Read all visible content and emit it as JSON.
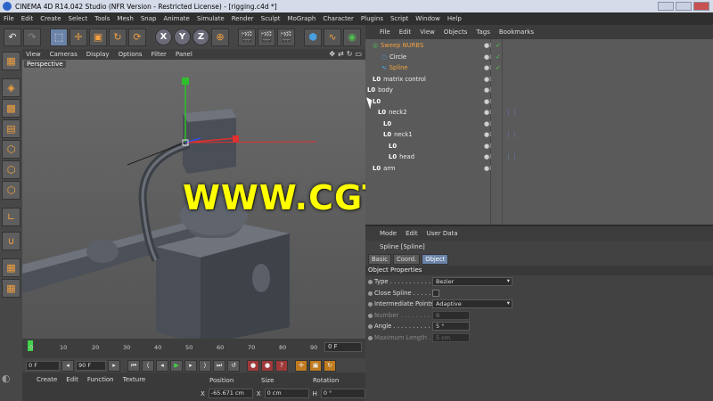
{
  "window": {
    "title": "CINEMA 4D R14.042 Studio (NFR Version - Restricted License) - [rigging.c4d *]"
  },
  "menubar": [
    "File",
    "Edit",
    "Create",
    "Select",
    "Tools",
    "Mesh",
    "Snap",
    "Animate",
    "Simulate",
    "Render",
    "Sculpt",
    "MoGraph",
    "Character",
    "Plugins",
    "Script",
    "Window",
    "Help"
  ],
  "toolbar": {
    "undo_icon": "undo-icon",
    "redo_icon": "redo-icon",
    "axis_x": "X",
    "axis_y": "Y",
    "axis_z": "Z"
  },
  "viewport": {
    "menu": [
      "View",
      "Cameras",
      "Display",
      "Options",
      "Filter",
      "Panel"
    ],
    "label": "Perspective"
  },
  "watermark": "WWW.CGTSJ.COM",
  "timeline": {
    "ticks": [
      "0",
      "10",
      "20",
      "30",
      "40",
      "50",
      "60",
      "70",
      "80",
      "90"
    ],
    "current_frame": "0 F"
  },
  "transport": {
    "start_field": "0 F",
    "end_field": "90 F"
  },
  "material_menu": [
    "Create",
    "Edit",
    "Function",
    "Texture"
  ],
  "coordinates": {
    "headers": [
      "Position",
      "Size",
      "Rotation"
    ],
    "x_label": "X",
    "position_x": "-65.671 cm",
    "size_label": "X",
    "size_x": "0 cm",
    "rot_label": "H",
    "rotation_h": "0 °"
  },
  "object_manager": {
    "menu": [
      "File",
      "Edit",
      "View",
      "Objects",
      "Tags",
      "Bookmarks"
    ],
    "rows": [
      {
        "name": "Sweep NURBS",
        "icon": "sweep-icon",
        "indent": 8,
        "color": "#f0a040"
      },
      {
        "name": "Circle",
        "icon": "circle-icon",
        "indent": 18,
        "color": "#eeeeee"
      },
      {
        "name": "Spline",
        "icon": "spline-icon",
        "indent": 18,
        "color": "#f0a040"
      },
      {
        "name": "matrix control",
        "icon": "null-icon",
        "indent": 8,
        "color": "#eeeeee"
      },
      {
        "name": "body",
        "icon": "null-icon",
        "indent": 2,
        "color": "#eeeeee"
      },
      {
        "name": "",
        "icon": "null-icon",
        "indent": 8,
        "color": "#eeeeee"
      },
      {
        "name": "neck2",
        "icon": "null-icon",
        "indent": 14,
        "color": "#eeeeee"
      },
      {
        "name": "",
        "icon": "null-icon",
        "indent": 20,
        "color": "#eeeeee"
      },
      {
        "name": "neck1",
        "icon": "null-icon",
        "indent": 20,
        "color": "#eeeeee"
      },
      {
        "name": "",
        "icon": "null-icon",
        "indent": 26,
        "color": "#eeeeee"
      },
      {
        "name": "head",
        "icon": "null-icon",
        "indent": 26,
        "color": "#eeeeee"
      },
      {
        "name": "arm",
        "icon": "null-icon",
        "indent": 8,
        "color": "#eeeeee"
      }
    ]
  },
  "attribute_manager": {
    "menu": [
      "Mode",
      "Edit",
      "User Data"
    ],
    "object_title": "Spline [Spline]",
    "tabs": [
      "Basic",
      "Coord.",
      "Object"
    ],
    "section": "Object Properties",
    "props": [
      {
        "label": "Type . . . . . . . . . . . .",
        "value": "Bezier",
        "kind": "dropdown",
        "dim": false
      },
      {
        "label": "Close Spline . . . . . .",
        "value": "",
        "kind": "checkbox",
        "dim": false
      },
      {
        "label": "Intermediate Points",
        "value": "Adaptive",
        "kind": "dropdown",
        "dim": false
      },
      {
        "label": "Number . . . . . . . . .",
        "value": "8",
        "kind": "field",
        "dim": true
      },
      {
        "label": "Angle . . . . . . . . . . . .",
        "value": "5 °",
        "kind": "field",
        "dim": false
      },
      {
        "label": "Maximum Length . .",
        "value": "5 cm",
        "kind": "field",
        "dim": true
      }
    ]
  },
  "colors": {
    "accent": "#6b83a8",
    "selected_object": "#f0a040",
    "watermark": "#ffff00",
    "play_button": "#43d04a"
  }
}
